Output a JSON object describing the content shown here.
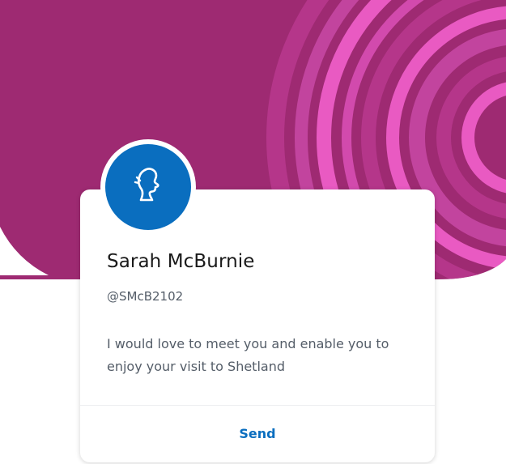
{
  "profile": {
    "name": "Sarah McBurnie",
    "handle": "@SMcB2102",
    "bio": "I would love to meet you and enable you to enjoy your visit to Shetland",
    "avatar_icon": "user-silhouette-icon"
  },
  "actions": {
    "send_label": "Send"
  },
  "colors": {
    "banner": "#9e2a72",
    "banner_stripe_light": "#e95ac2",
    "banner_stripe_mid": "#c2449e",
    "avatar_bg": "#0a6ebf",
    "accent": "#0a6ebf"
  }
}
